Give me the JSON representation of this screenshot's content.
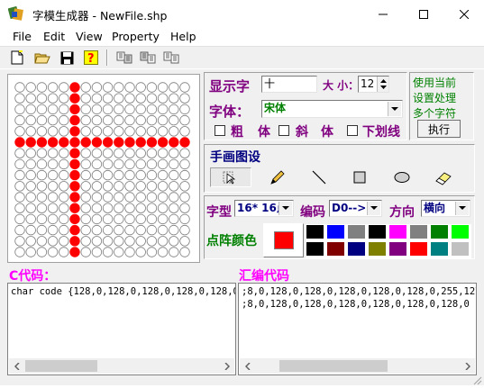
{
  "window": {
    "title": "字模生成器 - NewFile.shp"
  },
  "menu": [
    "File",
    "Edit",
    "View",
    "Property",
    "Help"
  ],
  "toolbar": {
    "help_glyph": "?"
  },
  "dot_matrix": {
    "rows": 16,
    "cols": 16,
    "on_color": "#ff0000",
    "off_color": "#ffffff",
    "lit_cols": [
      5
    ],
    "lit_rows": [
      5
    ]
  },
  "settings": {
    "char_label": "显示字",
    "char_value": "十",
    "size_label": "大 小：",
    "size_value": "12",
    "font_label": "字体：",
    "font_value": "宋体",
    "bold_label": "粗",
    "italic_label": "斜",
    "italic_suffix": "体",
    "underline_label": "下划线",
    "cut_char": "体"
  },
  "notes": {
    "line1": "使用当前",
    "line2": "设置处理",
    "line3": "多个字符",
    "execute_label": "执行"
  },
  "draw_tools": {
    "title": "手画图设"
  },
  "format": {
    "type_label": "字型",
    "type_value": "16* 16点",
    "encode_label": "编码",
    "encode_value": "D0-->D",
    "direction_label": "方向",
    "direction_value": "横向"
  },
  "color": {
    "label": "点阵颜色",
    "current": "#ff0000",
    "palette_top": [
      "#000000",
      "#0000ff",
      "#808080",
      "#000000",
      "#ff00ff",
      "#808080",
      "#008000",
      "#00ff00"
    ],
    "palette_bottom": [
      "#000000",
      "#800000",
      "#000080",
      "#808000",
      "#800080",
      "#ff0000",
      "#008080",
      "#c0c0c0"
    ]
  },
  "c_code": {
    "title": "C代码：",
    "line1": "char code  {128,0,128,0,128,0,128,0,128,0,128"
  },
  "asm_code": {
    "title": "汇编代码",
    "line1": ";8,0,128,0,128,0,128,0,128,0,128,0,255,127,128,0,",
    "line2": ";8,0,128,0,128,0,128,0,128,0,128,0,128,0"
  }
}
